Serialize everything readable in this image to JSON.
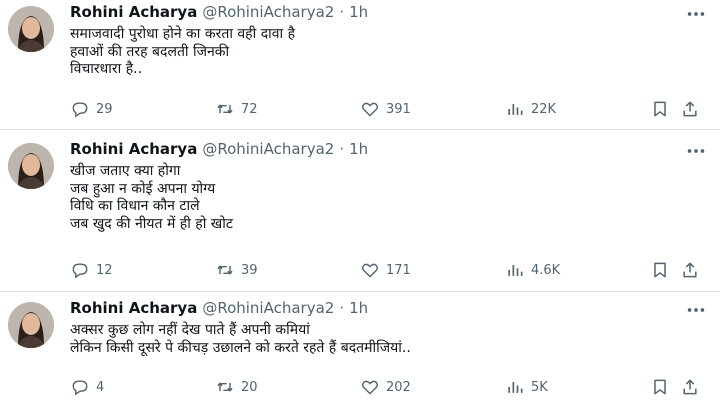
{
  "tweets": [
    {
      "name": "Rohini Acharya",
      "handle": "@RohiniAcharya2",
      "dot": "·",
      "time": "1h",
      "lines": [
        "समाजवादी पुरोधा होने का करता वही दावा है",
        "हवाओं की तरह बदलती जिनकी",
        "विचारधारा है.."
      ],
      "replies": "29",
      "retweets": "72",
      "likes": "391",
      "views": "22K"
    },
    {
      "name": "Rohini Acharya",
      "handle": "@RohiniAcharya2",
      "dot": "·",
      "time": "1h",
      "lines": [
        "खीज जताए क्या होगा",
        "जब हुआ न कोई अपना योग्य",
        "विधि का विधान कौन टाले",
        "जब खुद की नीयत में ही हो खोट"
      ],
      "replies": "12",
      "retweets": "39",
      "likes": "171",
      "views": "4.6K"
    },
    {
      "name": "Rohini Acharya",
      "handle": "@RohiniAcharya2",
      "dot": "·",
      "time": "1h",
      "lines": [
        "अक्सर कुछ लोग नहीं देख पाते हैं अपनी कमियां",
        "लेकिन किसी दूसरे पे कीचड़ उछालने को करते रहते हैं बदतमीजियां.."
      ],
      "replies": "4",
      "retweets": "20",
      "likes": "202",
      "views": "5K"
    }
  ],
  "colors": {
    "text": "#0f1419",
    "muted": "#536471",
    "divider": "#dfe3e6"
  },
  "icons": [
    "more-icon",
    "reply-icon",
    "retweet-icon",
    "like-icon",
    "views-icon",
    "bookmark-icon",
    "share-icon"
  ]
}
